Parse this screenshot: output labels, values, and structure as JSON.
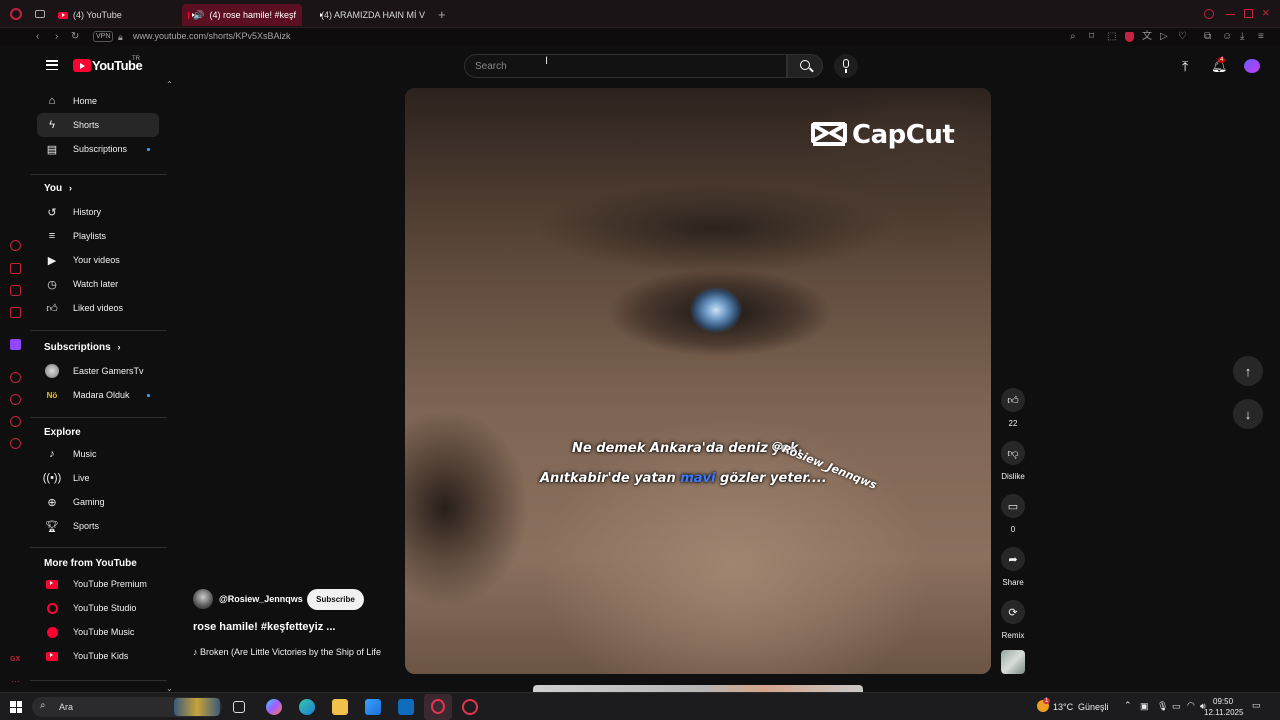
{
  "browser": {
    "tabs": [
      {
        "label": "(4) YouTube"
      },
      {
        "label": "(4) rose hamile! #keşf"
      },
      {
        "label": "(4) ARAMIZDA HAIN Mİ V"
      }
    ],
    "address": {
      "vpn_badge": "VPN",
      "url": "www.youtube.com/shorts/KPv5XsBAizk"
    },
    "notif_count": "4"
  },
  "header": {
    "logo_text": "YouTube",
    "country_code": "TR",
    "search_placeholder": "Search",
    "notification_badge": "4"
  },
  "sidebar": {
    "main": [
      {
        "label": "Home",
        "icon": "home-icon"
      },
      {
        "label": "Shorts",
        "icon": "shorts-icon"
      },
      {
        "label": "Subscriptions",
        "icon": "subscriptions-icon"
      }
    ],
    "you_heading": "You",
    "you_items": [
      {
        "label": "History",
        "icon": "history-icon"
      },
      {
        "label": "Playlists",
        "icon": "playlists-icon"
      },
      {
        "label": "Your videos",
        "icon": "your-videos-icon"
      },
      {
        "label": "Watch later",
        "icon": "watch-later-icon"
      },
      {
        "label": "Liked videos",
        "icon": "liked-videos-icon"
      }
    ],
    "subs_heading": "Subscriptions",
    "subs_items": [
      {
        "label": "Easter GamersTv"
      },
      {
        "label": "Madara Olduk"
      }
    ],
    "explore_heading": "Explore",
    "explore_items": [
      {
        "label": "Music",
        "icon": "music-icon"
      },
      {
        "label": "Live",
        "icon": "live-icon"
      },
      {
        "label": "Gaming",
        "icon": "gaming-icon"
      },
      {
        "label": "Sports",
        "icon": "sports-icon"
      }
    ],
    "more_heading": "More from YouTube",
    "more_items": [
      {
        "label": "YouTube Premium"
      },
      {
        "label": "YouTube Studio"
      },
      {
        "label": "YouTube Music"
      },
      {
        "label": "YouTube Kids"
      }
    ]
  },
  "short": {
    "watermark_brand": "CapCut",
    "caption_line1": "Ne demek Ankara'da deniz yok,",
    "caption_line2_a": "Anıtkabir'de yatan ",
    "caption_line2_b": "mavi",
    "caption_line2_c": " gözler yeter....",
    "caption_color_highlight": "#3b7bff",
    "overlay_handle": "@Rosiew_Jennqws",
    "channel": "@Rosiew_Jennqws",
    "subscribe_label": "Subscribe",
    "title": "rose hamile! #keşfetteyiz ...",
    "music": "Broken (Are Little Victories by the Ship of Life"
  },
  "actions": {
    "likes": "22",
    "dislike_label": "Dislike",
    "comments": "0",
    "share_label": "Share",
    "remix_label": "Remix"
  },
  "taskbar": {
    "search_label": "Ara",
    "weather_temp": "13°C",
    "weather_desc": "Güneşli",
    "weather_badge": "1",
    "time": "09:50",
    "date": "12.11.2025"
  },
  "colors": {
    "accent_red": "#ff0033",
    "opera_red": "#c4223f",
    "bg": "#0f0f0f"
  }
}
